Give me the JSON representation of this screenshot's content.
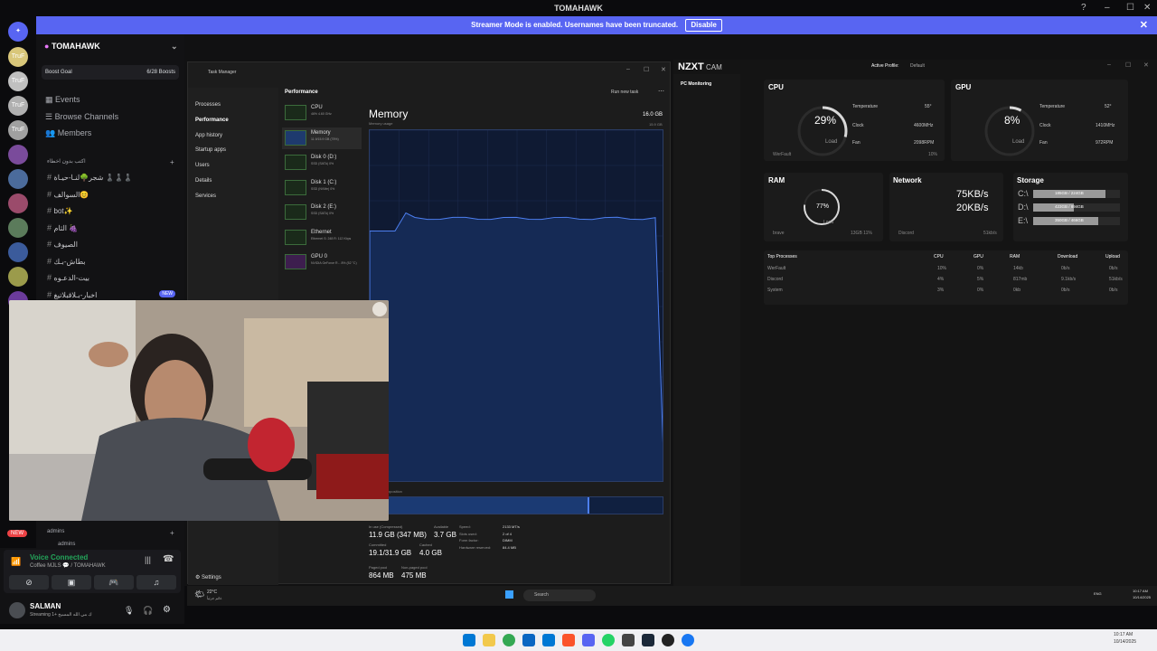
{
  "window": {
    "title": "TOMAHAWK"
  },
  "banner": {
    "text": "Streamer Mode is enabled. Usernames have been truncated.",
    "button": "Disable"
  },
  "server": {
    "name": "TOMAHAWK",
    "boost_goal": "Boost Goal",
    "boosts": "6/28 Boosts",
    "nav": [
      "Events",
      "Browse Channels",
      "Members"
    ],
    "category": "اكتب بدون اخطاء",
    "channels": [
      "شجر🌳لنـا-حيـاة ♟️♟️♟️",
      "السوالف😊",
      "bot✨",
      "الثام 🍇",
      "الصيوف",
      "بطاش-بـك",
      "بيت-الدعـوه",
      "اخبار-بـلاقبلاتيغ"
    ],
    "new_tag": "NEW",
    "category2": "admins",
    "channel_admin": "admins"
  },
  "voice": {
    "status": "Voice Connected",
    "channel": "Coffee MJLS 💬 / TOMAHAWK"
  },
  "user": {
    "name": "SALMAN",
    "status": "Streaming ك مي الله المسيح +1"
  },
  "new_badge": "NEW",
  "servers": [
    {
      "label": "TruF",
      "badge": ""
    },
    {
      "label": "TruF",
      "badge": "11"
    },
    {
      "label": "TruF",
      "badge": "4"
    },
    {
      "label": "TruF",
      "badge": "66"
    },
    {
      "label": "",
      "badge": ""
    },
    {
      "label": "",
      "badge": ""
    },
    {
      "label": "",
      "badge": ""
    },
    {
      "label": "",
      "badge": "23"
    },
    {
      "label": "",
      "badge": ""
    },
    {
      "label": "",
      "badge": ""
    },
    {
      "label": "",
      "badge": "130"
    }
  ],
  "task_manager": {
    "title": "Task Manager",
    "section": "Performance",
    "run_task": "Run new task",
    "nav": [
      "Processes",
      "Performance",
      "App history",
      "Startup apps",
      "Users",
      "Details",
      "Services"
    ],
    "settings": "Settings",
    "heading": "Memory",
    "capacity": "16.0 GB",
    "usage_label": "Memory usage",
    "usage_max": "15.9 GB",
    "composition_label": "Memory composition",
    "devices": [
      {
        "name": "CPU",
        "detail": "46% 4.60 GHz"
      },
      {
        "name": "Memory",
        "detail": "11.9/15.9 GB (75%)"
      },
      {
        "name": "Disk 0 (D:)",
        "detail": "SSD (SATA) 0%"
      },
      {
        "name": "Disk 1 (C:)",
        "detail": "SSD (NVMe) 0%"
      },
      {
        "name": "Disk 2 (E:)",
        "detail": "SSD (SATA) 0%"
      },
      {
        "name": "Ethernet",
        "detail": "Ethernet S: 248 R: 112 Kbps"
      },
      {
        "name": "GPU 0",
        "detail": "NVIDIA GeForce R... 8% (52 °C)"
      }
    ],
    "stats": [
      {
        "label": "In use (Compressed)",
        "value": "11.9 GB (347 MB)"
      },
      {
        "label": "Available",
        "value": "3.7 GB"
      },
      {
        "label": "Committed",
        "value": "19.1/31.9 GB"
      },
      {
        "label": "Cached",
        "value": "4.0 GB"
      },
      {
        "label": "Paged pool",
        "value": "864 MB"
      },
      {
        "label": "Non-paged pool",
        "value": "475 MB"
      }
    ],
    "specs": [
      {
        "label": "Speed:",
        "value": "2133 MT/s"
      },
      {
        "label": "Slots used:",
        "value": "2 of 4"
      },
      {
        "label": "Form factor:",
        "value": "DIMM"
      },
      {
        "label": "Hardware reserved:",
        "value": "84.4 MB"
      }
    ],
    "memory_usage_fraction": 0.75
  },
  "nzxt": {
    "brand": "NZXT",
    "brand2": "CAM",
    "profile_label": "Active Profile:",
    "profile": "Default",
    "menu": "PC Monitoring",
    "cpu": {
      "title": "CPU",
      "load": "29%",
      "load_label": "Load",
      "temp_label": "Temperature",
      "temp": "55°",
      "clock_label": "Clock",
      "clock": "4600MHz",
      "fan_label": "Fan",
      "fan": "2098RPM",
      "top": "WerFault",
      "top_val": "10%",
      "load_fraction": 0.29
    },
    "gpu": {
      "title": "GPU",
      "load": "8%",
      "load_label": "Load",
      "temp_label": "Temperature",
      "temp": "52°",
      "clock_label": "Clock",
      "clock": "1410MHz",
      "fan_label": "Fan",
      "fan": "972RPM",
      "load_fraction": 0.08
    },
    "ram": {
      "title": "RAM",
      "load": "77%",
      "load_label": "Load",
      "top": "brave",
      "top_val": "13GB 11%",
      "load_fraction": 0.77
    },
    "network": {
      "title": "Network",
      "down": "75KB/s",
      "up": "20KB/s",
      "top": "Discord",
      "top_val": "51kb/s"
    },
    "storage": {
      "title": "Storage",
      "drives": [
        {
          "letter": "C:\\",
          "text": "185GB / 224GB",
          "fraction": 0.83
        },
        {
          "letter": "D:\\",
          "text": "423GB / 894GB",
          "fraction": 0.47
        },
        {
          "letter": "E:\\",
          "text": "350GB / 466GB",
          "fraction": 0.75
        }
      ]
    },
    "processes": {
      "headers": [
        "Top Processes",
        "CPU",
        "GPU",
        "RAM",
        "Download",
        "Upload"
      ],
      "rows": [
        [
          "WerFault",
          "10%",
          "0%",
          "14kb",
          "0b/s",
          "0b/s"
        ],
        [
          "Discord",
          "4%",
          "5%",
          "817mb",
          "9.1kb/s",
          "51kb/s"
        ],
        [
          "System",
          "3%",
          "0%",
          "0kb",
          "0b/s",
          "0b/s"
        ]
      ]
    }
  },
  "inner_taskbar": {
    "weather": "22°C",
    "weather_sub": "غائم جزئياً",
    "search": "Search",
    "time": "10:17 AM",
    "date": "10/14/2025",
    "lang": "ENG"
  },
  "taskbar": {
    "time": "10:17 AM",
    "date": "10/14/2025"
  }
}
